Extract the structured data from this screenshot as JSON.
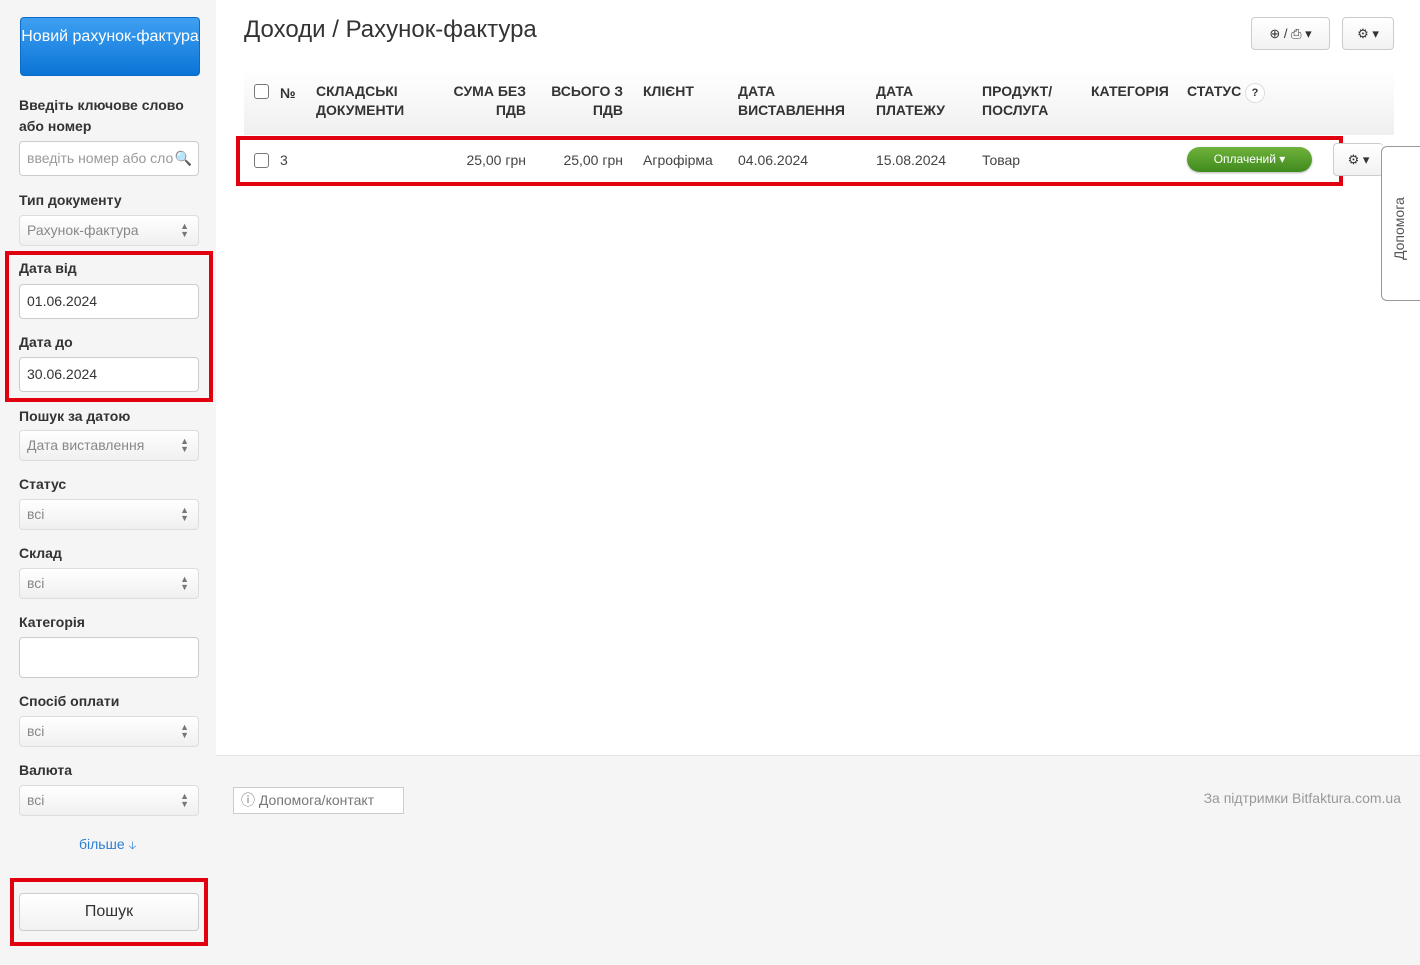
{
  "sidebar": {
    "new_button": "Новий рахунок-фактура",
    "keyword_label": "Введіть ключове слово або номер",
    "keyword_placeholder": "введіть номер або слово",
    "doc_type_label": "Тип документу",
    "doc_type_value": "Рахунок-фактура",
    "date_from_label": "Дата від",
    "date_from_value": "01.06.2024",
    "date_to_label": "Дата до",
    "date_to_value": "30.06.2024",
    "search_by_date_label": "Пошук за датою",
    "search_by_date_value": "Дата виставлення",
    "status_label": "Статус",
    "status_value": "всі",
    "warehouse_label": "Склад",
    "warehouse_value": "всі",
    "category_label": "Категорія",
    "category_value": "",
    "payment_label": "Спосіб оплати",
    "payment_value": "всі",
    "currency_label": "Валюта",
    "currency_value": "всі",
    "more_link": "більше",
    "search_button": "Пошук"
  },
  "header": {
    "title": "Доходи / Рахунок-фактура",
    "export_sep": "/"
  },
  "table": {
    "columns": [
      "№",
      "СКЛАДСЬКІ ДОКУМЕНТИ",
      "СУМА БЕЗ ПДВ",
      "ВСЬОГО З ПДВ",
      "КЛІЄНТ",
      "ДАТА ВИСТАВЛЕННЯ",
      "ДАТА ПЛАТЕЖУ",
      "ПРОДУКТ/ ПОСЛУГА",
      "КАТЕГОРІЯ",
      "СТАТУС"
    ],
    "status_help": "?",
    "rows": [
      {
        "number": "3",
        "warehouse_docs": "",
        "sum_no_vat": "25,00 грн",
        "total_vat": "25,00 грн",
        "client": "Агрофірма",
        "issue_date": "04.06.2024",
        "payment_date": "15.08.2024",
        "product": "Товар",
        "category": "",
        "status": "Оплачений"
      }
    ]
  },
  "help_tab": "Допомога",
  "footer": {
    "help_contact": "Допомога/контакт",
    "powered": "За підтримки Bitfaktura.com.ua"
  },
  "colors": {
    "accent": "#0a74d6",
    "status_paid": "#4f9a29",
    "highlight": "#e00010"
  }
}
